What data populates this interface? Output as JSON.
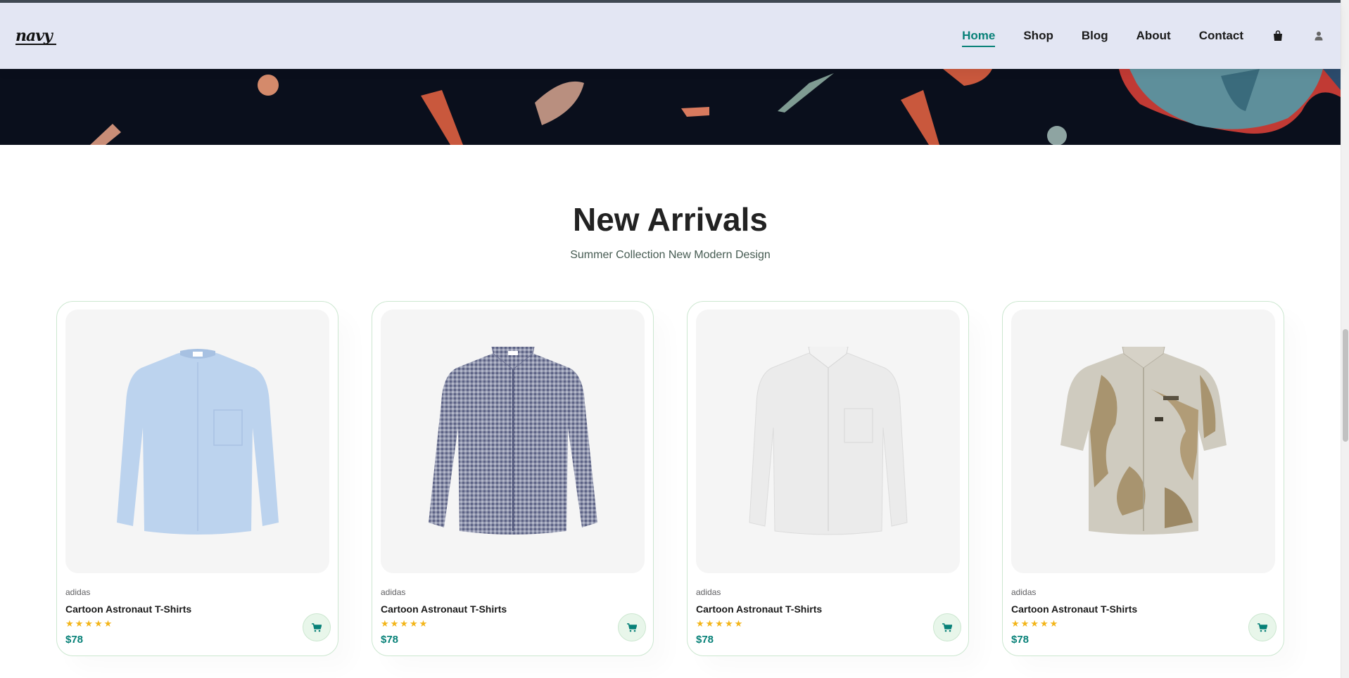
{
  "brand": {
    "logo_text": "navy"
  },
  "nav": {
    "items": [
      {
        "label": "Home",
        "active": true
      },
      {
        "label": "Shop",
        "active": false
      },
      {
        "label": "Blog",
        "active": false
      },
      {
        "label": "About",
        "active": false
      },
      {
        "label": "Contact",
        "active": false
      }
    ],
    "icons": [
      "shopping-bag-icon",
      "user-icon"
    ]
  },
  "section": {
    "title": "New Arrivals",
    "subtitle": "Summer Collection New Modern Design"
  },
  "products": [
    {
      "brand": "adidas",
      "name": "Cartoon Astronaut T-Shirts",
      "stars": "★★★★★",
      "rating": 5,
      "price": "$78",
      "image": "light-blue-shirt"
    },
    {
      "brand": "adidas",
      "name": "Cartoon Astronaut T-Shirts",
      "stars": "★★★★★",
      "rating": 5,
      "price": "$78",
      "image": "navy-gingham-shirt"
    },
    {
      "brand": "adidas",
      "name": "Cartoon Astronaut T-Shirts",
      "stars": "★★★★★",
      "rating": 5,
      "price": "$78",
      "image": "white-shirt"
    },
    {
      "brand": "adidas",
      "name": "Cartoon Astronaut T-Shirts",
      "stars": "★★★★★",
      "rating": 5,
      "price": "$78",
      "image": "beige-print-short-sleeve-shirt"
    }
  ],
  "colors": {
    "accent": "#088178",
    "header_bg": "#e3e6f3",
    "star": "#f3b519",
    "card_border": "#cce7d0",
    "hero_bg": "#0a0f1c"
  }
}
